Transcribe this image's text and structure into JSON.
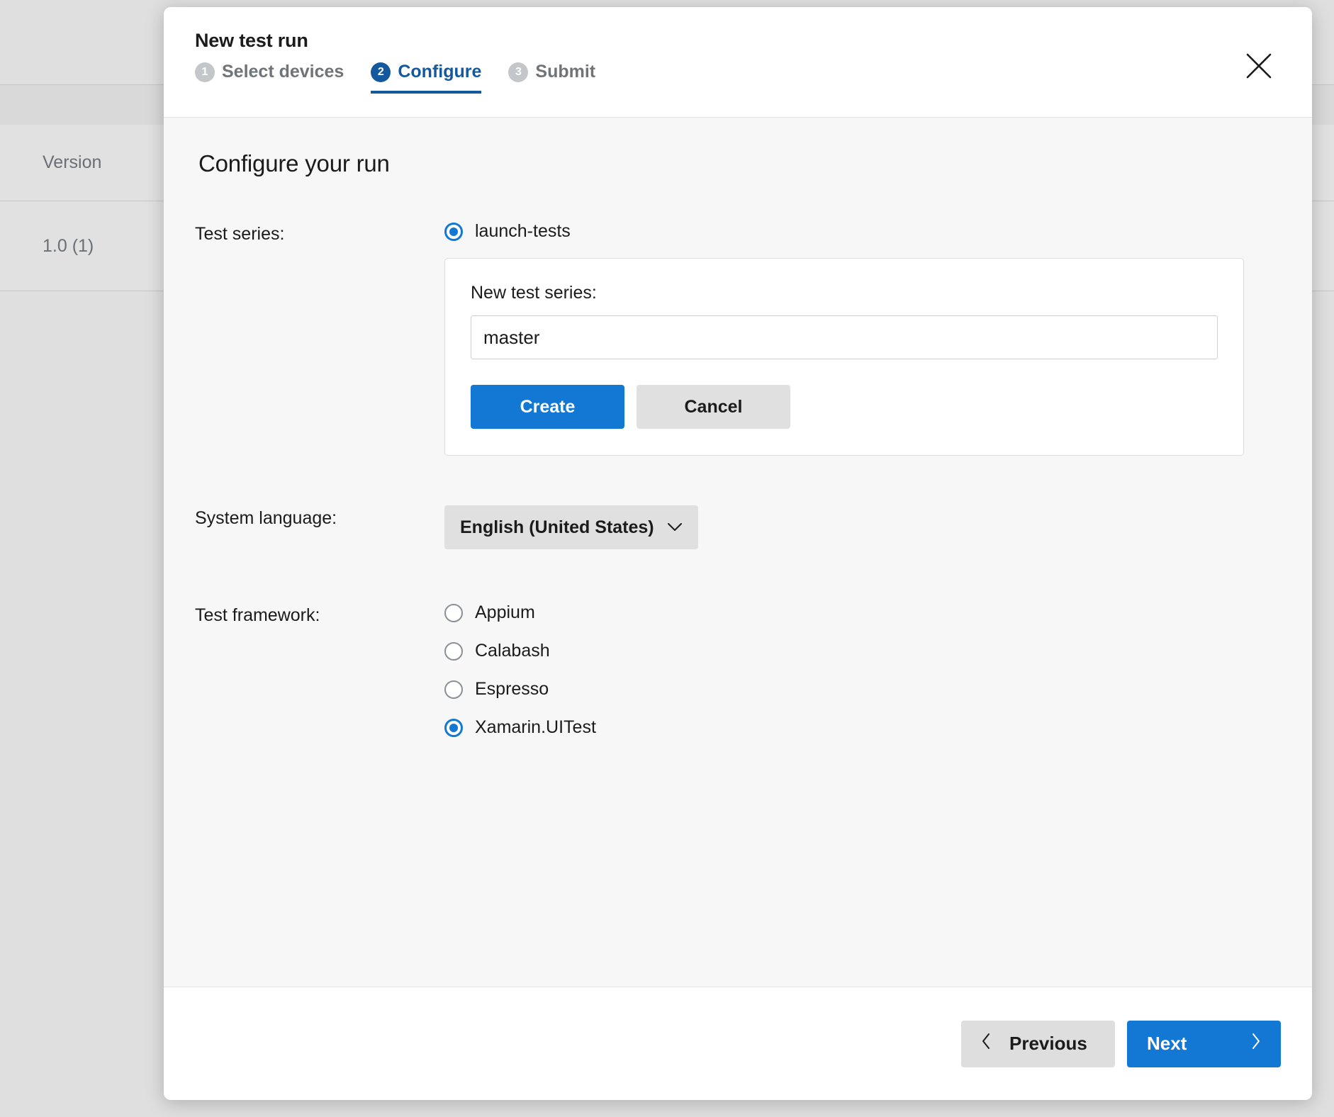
{
  "background": {
    "rows": [
      {
        "label": "Version"
      },
      {
        "label": "1.0 (1)"
      }
    ]
  },
  "modal": {
    "title": "New test run",
    "close_icon": "close-icon",
    "steps": [
      {
        "number": "1",
        "label": "Select devices",
        "active": false
      },
      {
        "number": "2",
        "label": "Configure",
        "active": true
      },
      {
        "number": "3",
        "label": "Submit",
        "active": false
      }
    ],
    "section_title": "Configure your run",
    "test_series": {
      "label": "Test series:",
      "options": [
        {
          "label": "launch-tests",
          "checked": true
        }
      ],
      "new_series": {
        "label": "New test series:",
        "input_value": "master",
        "input_placeholder": "",
        "create_label": "Create",
        "cancel_label": "Cancel"
      }
    },
    "system_language": {
      "label": "System language:",
      "selected": "English (United States)",
      "chevron_icon": "chevron-down-icon"
    },
    "test_framework": {
      "label": "Test framework:",
      "options": [
        {
          "label": "Appium",
          "checked": false
        },
        {
          "label": "Calabash",
          "checked": false
        },
        {
          "label": "Espresso",
          "checked": false
        },
        {
          "label": "Xamarin.UITest",
          "checked": true
        }
      ]
    },
    "footer": {
      "previous_label": "Previous",
      "next_label": "Next",
      "previous_icon": "chevron-left-icon",
      "next_icon": "chevron-right-icon"
    }
  },
  "colors": {
    "accent_blue": "#1278d4",
    "step_active": "#14599e",
    "modal_body_bg": "#f7f7f7",
    "backdrop": "#dfdfdf"
  }
}
